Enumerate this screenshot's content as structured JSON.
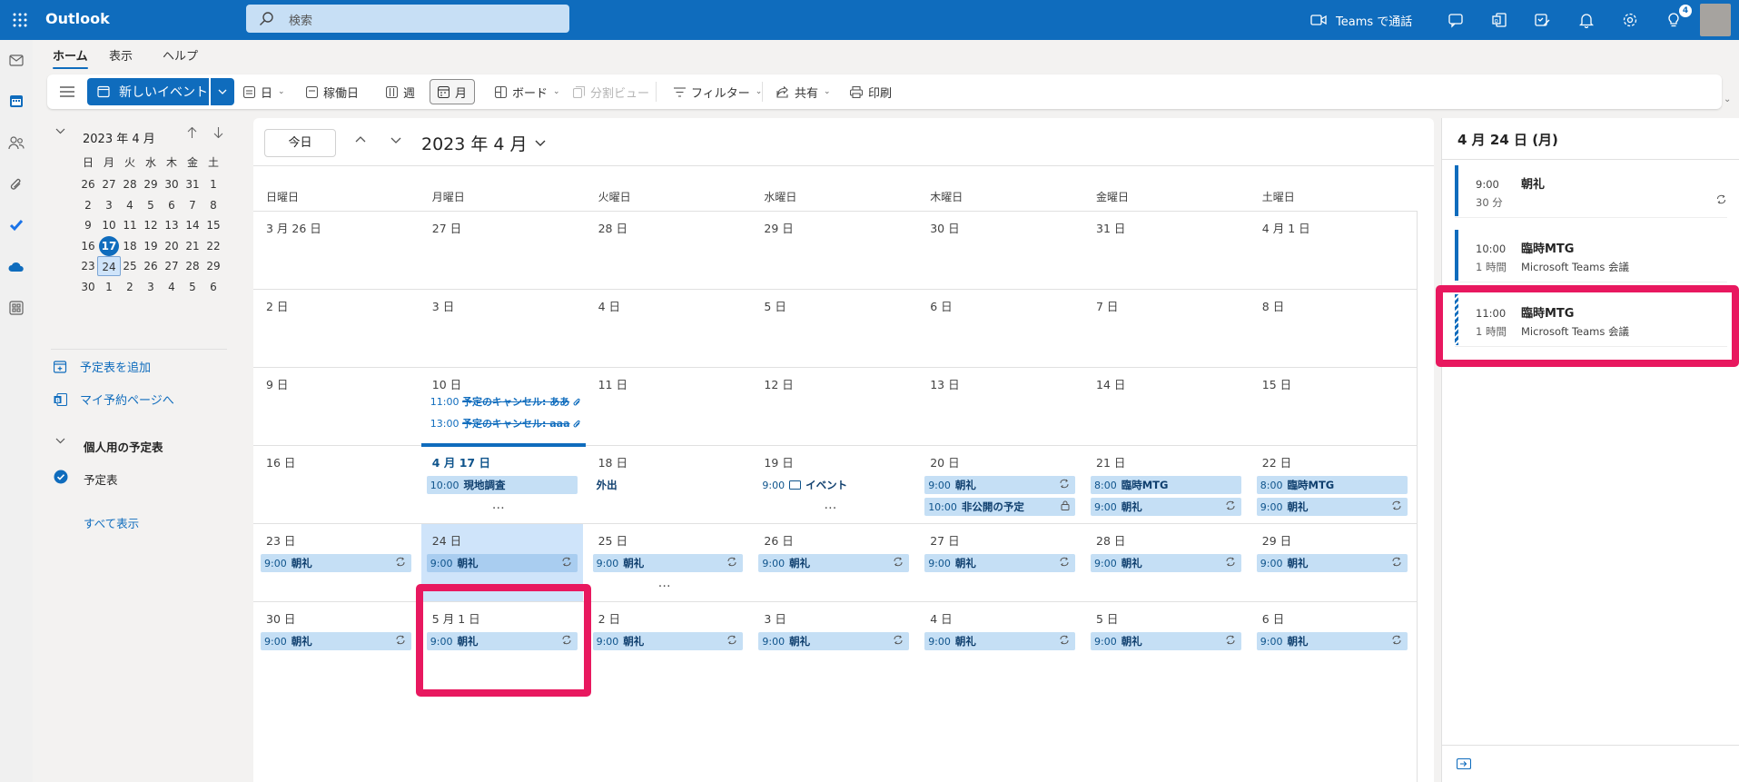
{
  "app": {
    "brand": "Outlook"
  },
  "search": {
    "placeholder": "検索"
  },
  "topbar": {
    "teams_call": "Teams で通話",
    "badge": "4"
  },
  "ribbon": {
    "tabs": [
      "ホーム",
      "表示",
      "ヘルプ"
    ],
    "new_event": "新しいイベント",
    "day": "日",
    "workweek": "稼働日",
    "week": "週",
    "month": "月",
    "board": "ボード",
    "split": "分割ビュー",
    "filter": "フィルター",
    "share": "共有",
    "print": "印刷"
  },
  "mini": {
    "title": "2023 年 4 月",
    "dows": [
      "日",
      "月",
      "火",
      "水",
      "木",
      "金",
      "土"
    ],
    "weeks": [
      [
        "26",
        "27",
        "28",
        "29",
        "30",
        "31",
        "1"
      ],
      [
        "2",
        "3",
        "4",
        "5",
        "6",
        "7",
        "8"
      ],
      [
        "9",
        "10",
        "11",
        "12",
        "13",
        "14",
        "15"
      ],
      [
        "16",
        "17",
        "18",
        "19",
        "20",
        "21",
        "22"
      ],
      [
        "23",
        "24",
        "25",
        "26",
        "27",
        "28",
        "29"
      ],
      [
        "30",
        "1",
        "2",
        "3",
        "4",
        "5",
        "6"
      ]
    ]
  },
  "leftnav": {
    "add_calendar": "予定表を追加",
    "booking": "マイ予約ページへ",
    "group": "個人用の予定表",
    "calendar": "予定表",
    "show_all": "すべて表示"
  },
  "main": {
    "today": "今日",
    "title": "2023 年 4 月",
    "dows": [
      "日曜日",
      "月曜日",
      "火曜日",
      "水曜日",
      "木曜日",
      "金曜日",
      "土曜日"
    ],
    "weeks": [
      [
        "3 月 26 日",
        "27 日",
        "28 日",
        "29 日",
        "30 日",
        "31 日",
        "4 月 1 日"
      ],
      [
        "2 日",
        "3 日",
        "4 日",
        "5 日",
        "6 日",
        "7 日",
        "8 日"
      ],
      [
        "9 日",
        "10 日",
        "11 日",
        "12 日",
        "13 日",
        "14 日",
        "15 日"
      ],
      [
        "16 日",
        "4 月 17 日",
        "18 日",
        "19 日",
        "20 日",
        "21 日",
        "22 日"
      ],
      [
        "23 日",
        "24 日",
        "25 日",
        "26 日",
        "27 日",
        "28 日",
        "29 日"
      ],
      [
        "30 日",
        "5 月 1 日",
        "2 日",
        "3 日",
        "4 日",
        "5 日",
        "6 日"
      ]
    ],
    "more": "…",
    "events": {
      "cancel1": {
        "time": "11:00",
        "name": "予定のキャンセル: ああ"
      },
      "cancel2": {
        "time": "13:00",
        "name": "予定のキャンセル: aaa"
      },
      "genchi": {
        "time": "10:00",
        "name": "現地調査"
      },
      "gaishutsu": {
        "name": "外出"
      },
      "event19": {
        "time": "9:00",
        "name": "イベント"
      },
      "chorei": {
        "time": "9:00",
        "name": "朝礼"
      },
      "hikokai": {
        "time": "10:00",
        "name": "非公開の予定"
      },
      "rinji": {
        "time": "8:00",
        "name": "臨時MTG"
      }
    }
  },
  "right": {
    "title": "4 月 24 日 (月)",
    "items": [
      {
        "time": "9:00",
        "dur": "30 分",
        "name": "朝礼",
        "sub": ""
      },
      {
        "time": "10:00",
        "dur": "1 時間",
        "name": "臨時MTG",
        "sub": "Microsoft Teams 会議"
      },
      {
        "time": "11:00",
        "dur": "1 時間",
        "name": "臨時MTG",
        "sub": "Microsoft Teams 会議"
      }
    ]
  },
  "colors": {
    "brand": "#0f6cbd",
    "event_bg": "#c5dff5",
    "highlight": "#e8185f"
  }
}
